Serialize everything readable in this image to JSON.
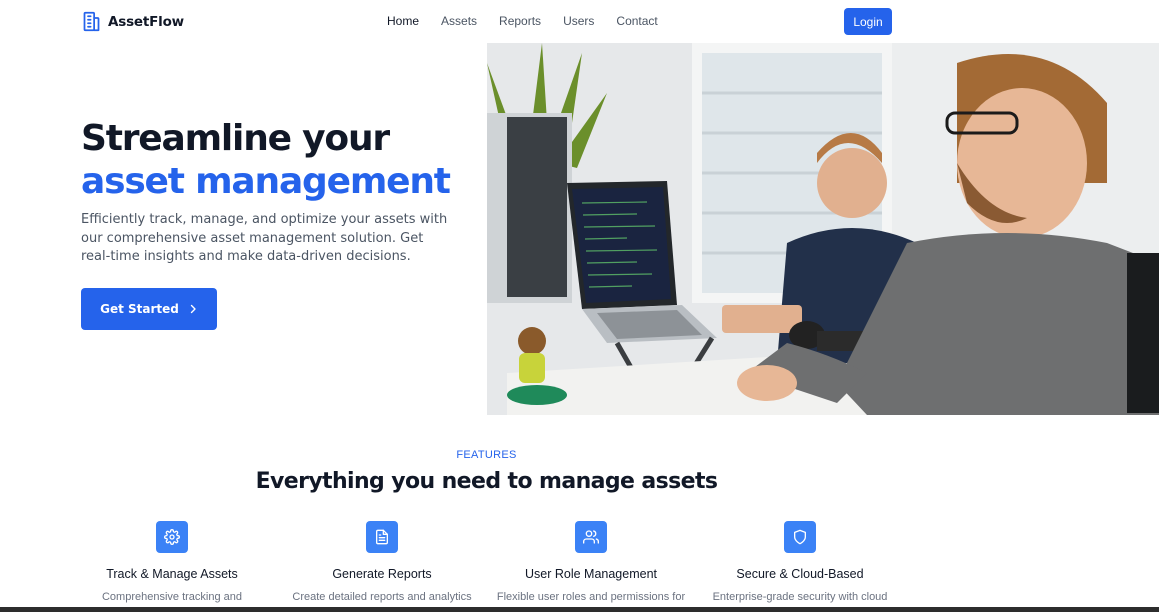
{
  "brand": {
    "name": "AssetFlow",
    "accent": "#2563eb"
  },
  "nav": {
    "links": [
      "Home",
      "Assets",
      "Reports",
      "Users",
      "Contact"
    ],
    "active": "Home",
    "login_label": "Login"
  },
  "hero": {
    "title_line1": "Streamline your",
    "title_line2": "asset management",
    "description": "Efficiently track, manage, and optimize your assets with our comprehensive asset management solution. Get real-time insights and make data-driven decisions.",
    "cta_label": "Get Started",
    "cta_icon": "chevron-right-icon"
  },
  "features": {
    "eyebrow": "FEATURES",
    "title": "Everything you need to manage assets",
    "items": [
      {
        "icon": "gear-icon",
        "title": "Track & Manage Assets",
        "description": "Comprehensive tracking and"
      },
      {
        "icon": "document-icon",
        "title": "Generate Reports",
        "description": "Create detailed reports and analytics"
      },
      {
        "icon": "users-icon",
        "title": "User Role Management",
        "description": "Flexible user roles and permissions for"
      },
      {
        "icon": "shield-icon",
        "title": "Secure & Cloud-Based",
        "description": "Enterprise-grade security with cloud"
      }
    ]
  }
}
